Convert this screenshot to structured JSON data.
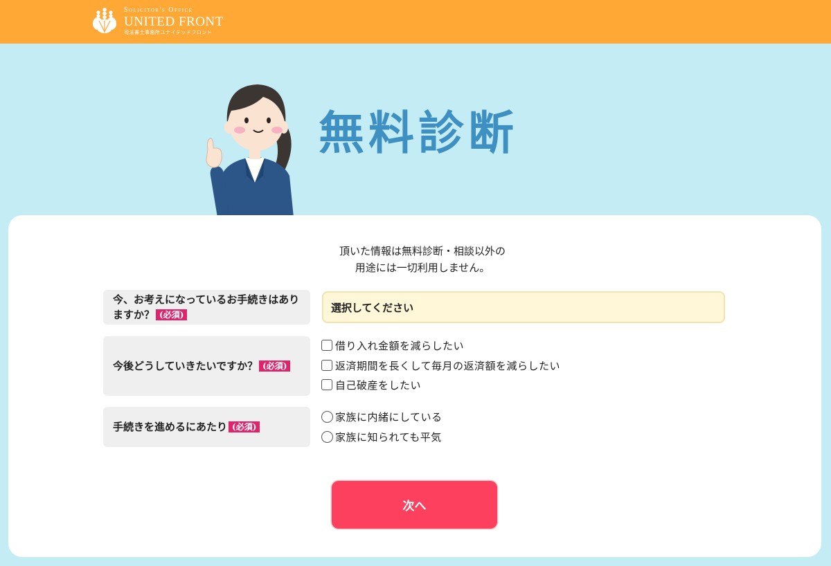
{
  "header": {
    "brand_line1": "Solicitor's Office",
    "brand_line2": "UNITED FRONT",
    "brand_line3": "司法書士事務所ユナイテッドフロント",
    "background_color": "#ffa836"
  },
  "hero": {
    "title": "無料診断",
    "illustration": "woman-pointing-illustration"
  },
  "form": {
    "notice_line1": "頂いた情報は無料診断・相談以外の",
    "notice_line2": "用途には一切利用しません。",
    "required_label": "(必須)",
    "q1": {
      "label": "今、お考えになっているお手続きはありますか？",
      "select_value": "選択してください"
    },
    "q2": {
      "label": "今後どうしていきたいですか？",
      "options": [
        "借り入れ金額を減らしたい",
        "返済期間を長くして毎月の返済額を減らしたい",
        "自己破産をしたい"
      ]
    },
    "q3": {
      "label": "手続きを進めるにあたり",
      "options": [
        "家族に内緒にしている",
        "家族に知られても平気"
      ]
    },
    "next_button": "次へ"
  },
  "colors": {
    "page_background": "#c4ecf4",
    "title_color": "#3e8fc2",
    "required_badge": "#e0246b",
    "button": "#fc405d",
    "select_background": "#fff7d8"
  }
}
